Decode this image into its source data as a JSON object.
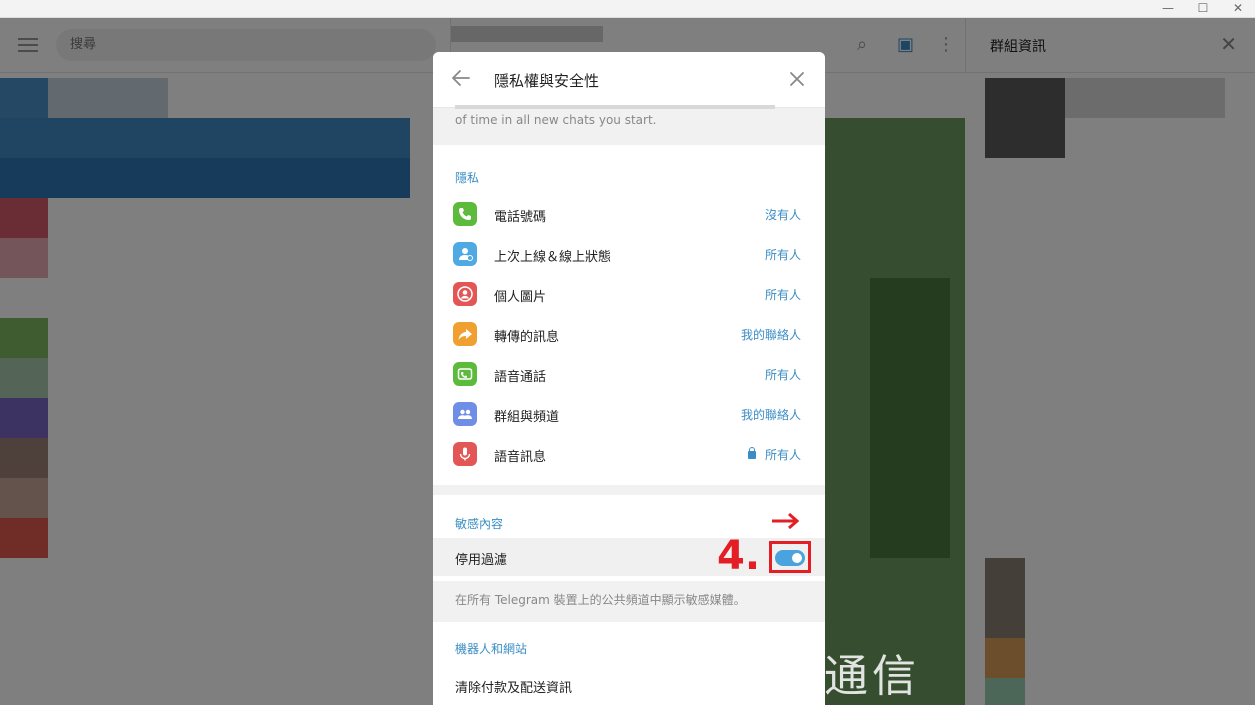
{
  "window": {
    "minimize_glyph": "—",
    "maximize_glyph": "☐",
    "close_glyph": "✕"
  },
  "left": {
    "search_placeholder": "搜尋"
  },
  "right_panel": {
    "title": "群組資訊"
  },
  "modal": {
    "title": "隱私權與安全性",
    "previous_note": "of time in all new chats you start.",
    "privacy": {
      "title": "隱私",
      "items": [
        {
          "label": "電話號碼",
          "value": "沒有人",
          "icon": "phone-icon",
          "color": "#5cba3c"
        },
        {
          "label": "上次上線＆線上狀態",
          "value": "所有人",
          "icon": "person-icon",
          "color": "#4fa9e3"
        },
        {
          "label": "個人圖片",
          "value": "所有人",
          "icon": "profile-photo-icon",
          "color": "#e25656"
        },
        {
          "label": "轉傳的訊息",
          "value": "我的聯絡人",
          "icon": "forward-icon",
          "color": "#f0a030"
        },
        {
          "label": "語音通話",
          "value": "所有人",
          "icon": "video-call-icon",
          "color": "#5cba3c"
        },
        {
          "label": "群組與頻道",
          "value": "我的聯絡人",
          "icon": "group-icon",
          "color": "#6f8ee6"
        },
        {
          "label": "語音訊息",
          "value": "所有人",
          "icon": "microphone-icon",
          "color": "#e25656",
          "locked": true
        }
      ]
    },
    "sensitive": {
      "title": "敏感內容",
      "toggle_label": "停用過濾",
      "toggle_on": true,
      "hint": "在所有 Telegram 裝置上的公共頻道中顯示敏感媒體。"
    },
    "bots": {
      "title": "機器人和網站",
      "clear_payment": "清除付款及配送資訊"
    }
  },
  "annotation": {
    "step": "4."
  },
  "watermark": "傑昇通信",
  "colors": {
    "accent": "#3a8dc4",
    "toggle": "#4aa3df",
    "annotation_red": "#e31e24"
  }
}
